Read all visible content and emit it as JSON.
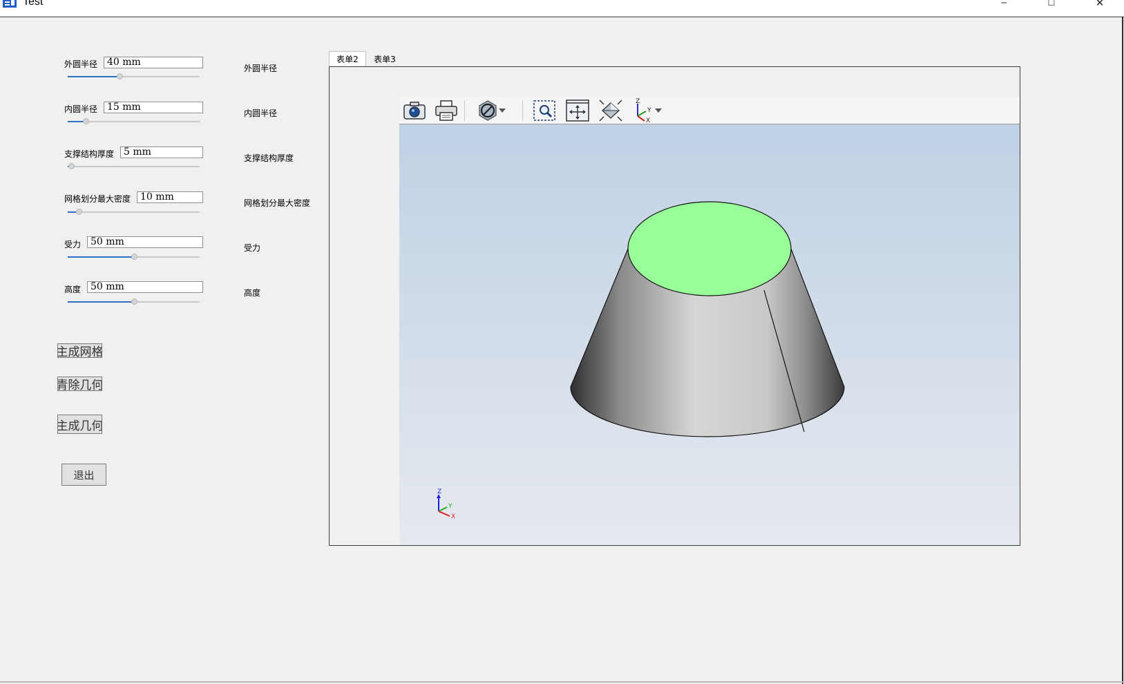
{
  "window": {
    "title": "Test",
    "minimize_glyph": "─",
    "maximize_glyph": "☐",
    "close_glyph": "✕"
  },
  "params": [
    {
      "label": "外圆半径",
      "value": "40  mm",
      "slider_fraction": 0.4,
      "right_label": "外圆半径"
    },
    {
      "label": "内圆半径",
      "value": "15  mm",
      "slider_fraction": 0.14,
      "right_label": "内圆半径"
    },
    {
      "label": "支撑结构厚度",
      "value": "5  mm",
      "slider_fraction": 0.03,
      "right_label": "支撑结构厚度"
    },
    {
      "label": "网格划分最大密度",
      "value": "10  mm",
      "slider_fraction": 0.09,
      "right_label": "网格划分最大密度"
    },
    {
      "label": "受力",
      "value": "50  mm",
      "slider_fraction": 0.51,
      "right_label": "受力"
    },
    {
      "label": "高度",
      "value": "50  mm",
      "slider_fraction": 0.51,
      "right_label": "高度"
    }
  ],
  "buttons": {
    "generate_mesh": "主成网格",
    "clear_geometry": "青除几何",
    "generate_geometry": "主成几何",
    "exit": "退出"
  },
  "tabs": [
    {
      "label": "表单2",
      "active": true
    },
    {
      "label": "表单3",
      "active": false
    }
  ],
  "viewer": {
    "toolbar_icons": [
      "camera-icon",
      "print-icon",
      "clip-plane-icon",
      "zoom-area-icon",
      "fit-all-icon",
      "isometric-view-icon",
      "axis-view-icon"
    ],
    "axes": {
      "x": "X",
      "y": "Y",
      "z": "Z"
    },
    "colors": {
      "top_face": "#98ff98",
      "side_light": "#d4d4d4",
      "side_dark": "#303030",
      "bg_top": "#bfd1e5",
      "bg_bottom": "#e6e9ee",
      "axis_x": "#e02020",
      "axis_y": "#20b020",
      "axis_z": "#2020e0"
    }
  }
}
